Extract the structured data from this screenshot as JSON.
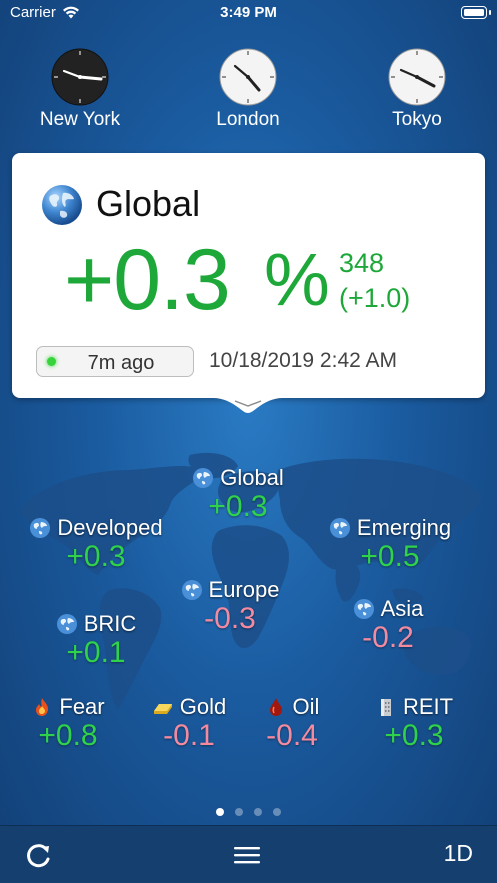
{
  "status_bar": {
    "carrier": "Carrier",
    "time": "3:49 PM"
  },
  "clocks": [
    {
      "city": "New York",
      "style": "dark",
      "hour_angle": 105,
      "minute_angle": 294
    },
    {
      "city": "London",
      "style": "light",
      "hour_angle": 225,
      "minute_angle": 294
    },
    {
      "city": "Tokyo",
      "style": "light",
      "hour_angle": 135,
      "minute_angle": 294
    }
  ],
  "card": {
    "title": "Global",
    "change": "+0.3",
    "percent_sign": "%",
    "index_value": "348",
    "index_delta": "(+1.0)",
    "age": "7m ago",
    "datetime": "10/18/2019 2:42 AM"
  },
  "regions": {
    "global": {
      "name": "Global",
      "value": "+0.3",
      "trend": "pos"
    },
    "developed": {
      "name": "Developed",
      "value": "+0.3",
      "trend": "pos"
    },
    "emerging": {
      "name": "Emerging",
      "value": "+0.5",
      "trend": "pos"
    },
    "europe": {
      "name": "Europe",
      "value": "-0.3",
      "trend": "neg"
    },
    "asia": {
      "name": "Asia",
      "value": "-0.2",
      "trend": "neg"
    },
    "bric": {
      "name": "BRIC",
      "value": "+0.1",
      "trend": "pos"
    },
    "fear": {
      "name": "Fear",
      "value": "+0.8",
      "trend": "pos"
    },
    "gold": {
      "name": "Gold",
      "value": "-0.1",
      "trend": "neg"
    },
    "oil": {
      "name": "Oil",
      "value": "-0.4",
      "trend": "neg"
    },
    "reit": {
      "name": "REIT",
      "value": "+0.3",
      "trend": "pos"
    }
  },
  "page_indicator": {
    "count": 4,
    "active": 1
  },
  "toolbar": {
    "range_label": "1D"
  },
  "colors": {
    "positive": "#2fd24a",
    "negative": "#f38aa0",
    "card_positive": "#1fa83a"
  },
  "icons": [
    "wifi-icon",
    "battery-icon",
    "globe-icon",
    "flame-icon",
    "gold-bar-icon",
    "oil-drop-icon",
    "building-icon",
    "refresh-icon",
    "menu-icon"
  ]
}
